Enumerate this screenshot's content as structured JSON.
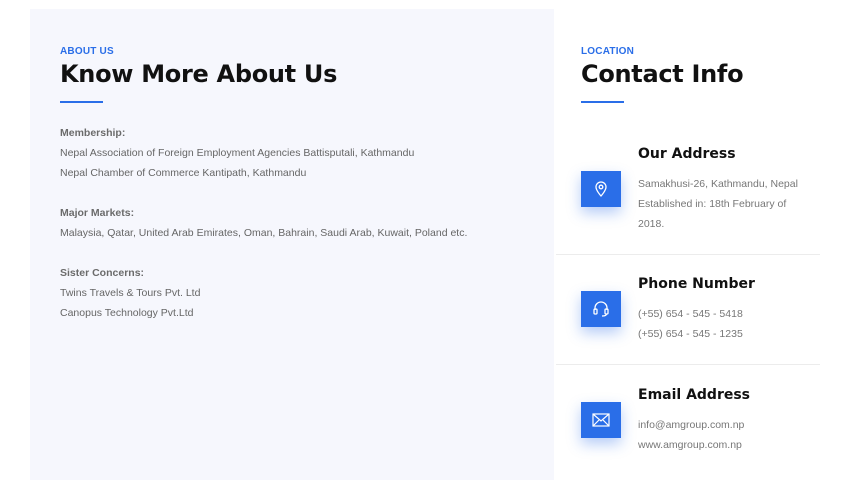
{
  "about": {
    "eyebrow": "ABOUT US",
    "title": "Know More About Us",
    "membership": {
      "label": "Membership:",
      "lines": [
        "Nepal Association of Foreign Employment Agencies Battisputali, Kathmandu",
        "Nepal Chamber of Commerce Kantipath, Kathmandu"
      ]
    },
    "markets": {
      "label": "Major Markets:",
      "lines": [
        "Malaysia, Qatar, United Arab Emirates, Oman, Bahrain, Saudi Arab, Kuwait, Poland etc."
      ]
    },
    "concerns": {
      "label": "Sister Concerns:",
      "lines": [
        "Twins Travels & Tours Pvt. Ltd",
        "Canopus Technology Pvt.Ltd"
      ]
    }
  },
  "contact": {
    "eyebrow": "LOCATION",
    "title": "Contact Info",
    "address": {
      "icon": "location-pin-icon",
      "title": "Our Address",
      "lines": [
        "Samakhusi-26, Kathmandu, Nepal",
        "Established in: 18th February of 2018."
      ]
    },
    "phone": {
      "icon": "headset-icon",
      "title": "Phone Number",
      "lines": [
        "(+55) 654 - 545 - 5418",
        "(+55) 654 - 545 - 1235"
      ]
    },
    "email": {
      "icon": "envelope-icon",
      "title": "Email Address",
      "lines": [
        "info@amgroup.com.np",
        "www.amgroup.com.np"
      ]
    }
  },
  "colors": {
    "accent": "#2a6ee8",
    "panel": "#f6f7fd",
    "heading": "#111111",
    "body_text": "#777777"
  }
}
